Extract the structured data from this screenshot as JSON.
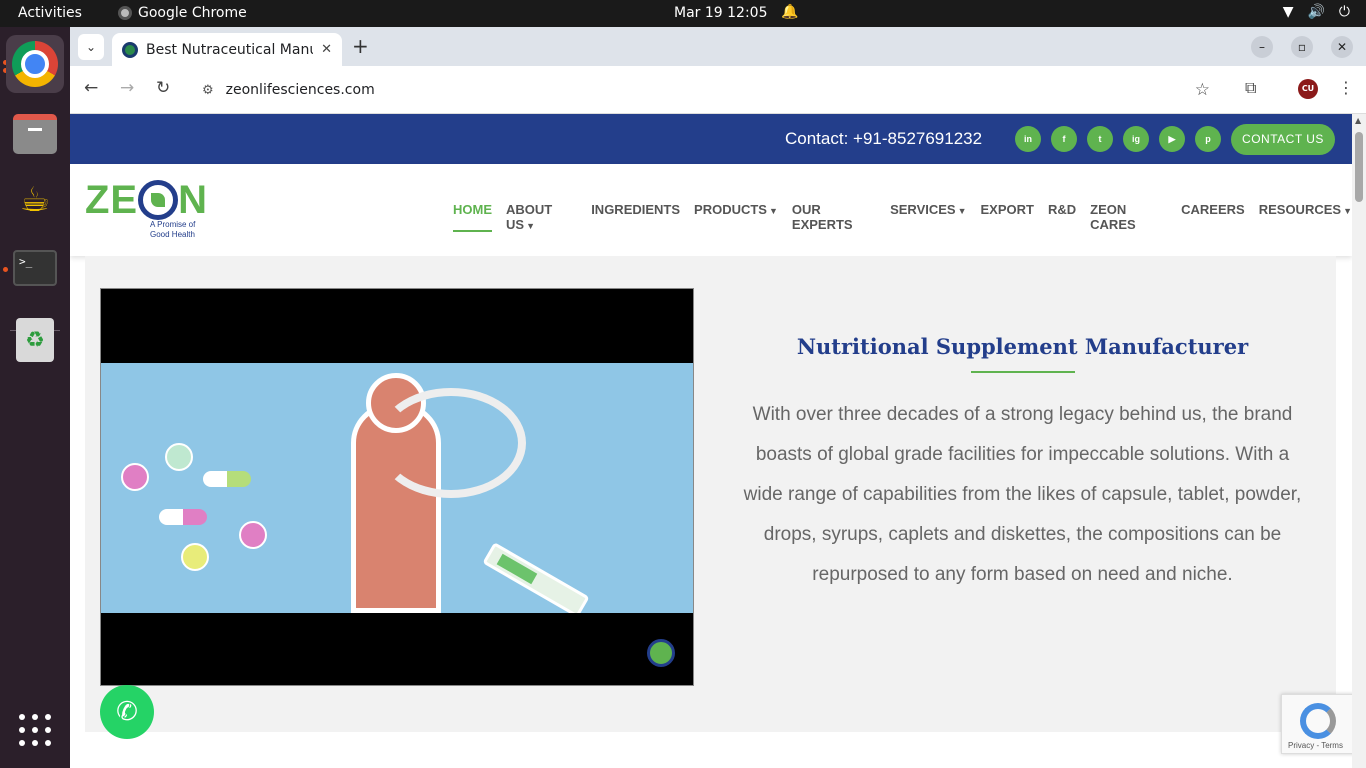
{
  "system": {
    "activities": "Activities",
    "app_name": "Google Chrome",
    "clock": "Mar 19  12:05"
  },
  "dock": {
    "items": [
      {
        "name": "chrome-icon"
      },
      {
        "name": "files-icon"
      },
      {
        "name": "teapot-icon"
      },
      {
        "name": "terminal-icon"
      },
      {
        "name": "trash-icon"
      }
    ],
    "terminal_glyph": ">_"
  },
  "browser": {
    "tab_title": "Best Nutraceutical Manu",
    "url": "zeonlifesciences.com",
    "profile_initials": "CU"
  },
  "site": {
    "contact_text": "Contact: +91-8527691232",
    "social": [
      {
        "label": "in",
        "icon": "linkedin-icon"
      },
      {
        "label": "f",
        "icon": "facebook-icon"
      },
      {
        "label": "t",
        "icon": "twitter-icon"
      },
      {
        "label": "ig",
        "icon": "instagram-icon"
      },
      {
        "label": "▶",
        "icon": "youtube-icon"
      },
      {
        "label": "p",
        "icon": "pinterest-icon"
      }
    ],
    "contact_button": "CONTACT US",
    "logo_text": "ZE",
    "logo_text_end": "N",
    "logo_tagline": "A Promise of Good Health",
    "nav": [
      {
        "label": "HOME",
        "active": true
      },
      {
        "label": "ABOUT US",
        "dropdown": true
      },
      {
        "label": "INGREDIENTS"
      },
      {
        "label": "PRODUCTS",
        "dropdown": true
      },
      {
        "label": "OUR EXPERTS"
      },
      {
        "label": "SERVICES",
        "dropdown": true
      },
      {
        "label": "EXPORT"
      },
      {
        "label": "R&D"
      },
      {
        "label": "ZEON CARES"
      },
      {
        "label": "CAREERS"
      },
      {
        "label": "RESOURCES",
        "dropdown": true
      }
    ],
    "section": {
      "heading": "Nutritional Supplement Manufacturer",
      "paragraph": "With over three decades of a strong legacy behind us, the brand boasts of global grade facilities for impeccable solutions. With a wide range of capabilities from the likes of capsule, tablet, powder, drops, syrups, caplets and diskettes, the compositions can be repurposed to any form based on need and niche."
    },
    "recaptcha_text": "Privacy - Terms"
  },
  "colors": {
    "brand_blue": "#233e8b",
    "brand_green": "#5fb34f",
    "whatsapp_green": "#25d366"
  }
}
